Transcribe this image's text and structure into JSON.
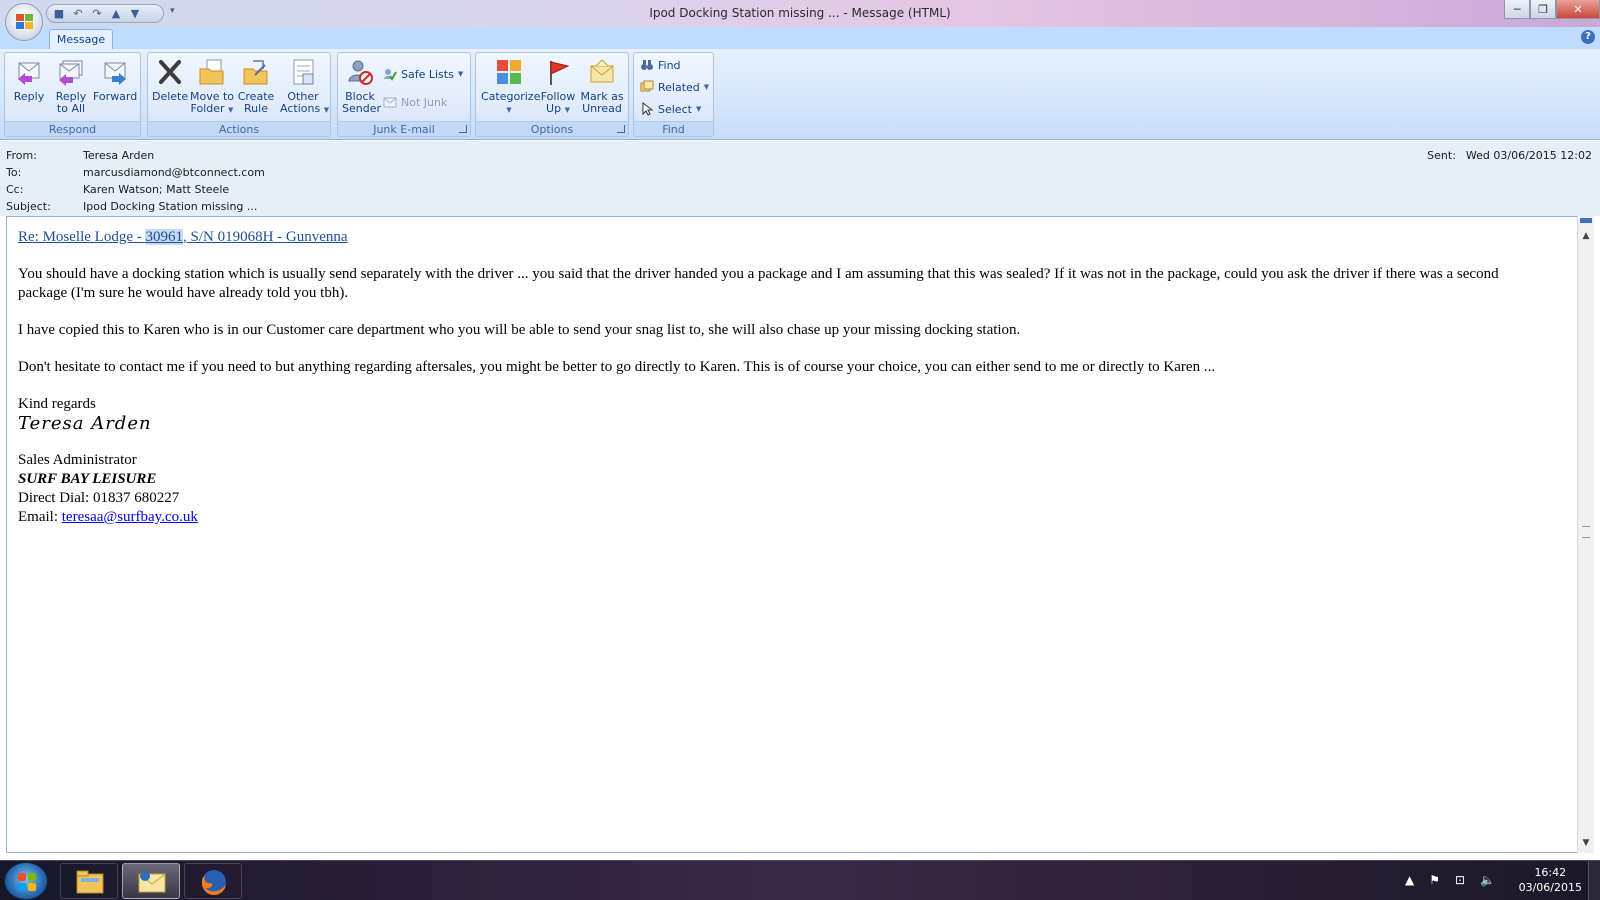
{
  "window": {
    "title": "Ipod Docking Station missing ... - Message (HTML)",
    "controls": {
      "minimize": "─",
      "maximize": "❐",
      "close": "✕"
    }
  },
  "quick_access": {
    "more": "▾"
  },
  "tabs": [
    {
      "label": "Message"
    }
  ],
  "help": "?",
  "ribbon": {
    "respond": {
      "label": "Respond",
      "reply": "Reply",
      "reply_all_1": "Reply",
      "reply_all_2": "to All",
      "forward": "Forward"
    },
    "actions": {
      "label": "Actions",
      "delete": "Delete",
      "move_1": "Move to",
      "move_2": "Folder",
      "rule_1": "Create",
      "rule_2": "Rule",
      "other_1": "Other",
      "other_2": "Actions"
    },
    "junk": {
      "label": "Junk E-mail",
      "block_1": "Block",
      "block_2": "Sender",
      "safe_lists": "Safe Lists",
      "not_junk": "Not Junk"
    },
    "options": {
      "label": "Options",
      "categorize": "Categorize",
      "follow_1": "Follow",
      "follow_2": "Up",
      "mark_1": "Mark as",
      "mark_2": "Unread"
    },
    "find": {
      "label": "Find",
      "find": "Find",
      "related": "Related",
      "select": "Select"
    }
  },
  "header": {
    "from_label": "From:",
    "from": "Teresa Arden",
    "to_label": "To:",
    "to": "marcusdiamond@btconnect.com",
    "cc_label": "Cc:",
    "cc": "Karen Watson; Matt Steele",
    "subject_label": "Subject:",
    "subject": "Ipod Docking Station missing ...",
    "sent_label": "Sent:",
    "sent": "Wed 03/06/2015 12:02"
  },
  "body": {
    "re_prefix": "Re:  Moselle Lodge - ",
    "re_highlight": "30961",
    "re_suffix": ", S/N 019068H - Gunvenna",
    "p1": "You should have a docking station which is usually send separately with the driver ... you said that the driver handed you a package and I am assuming that this was sealed?  If it was not in the package, could you ask the driver if there was a second package (I'm sure he would have already told you tbh).",
    "p2": "I have copied this to Karen who is in our Customer care department who you will be able to send your snag list to, she will also chase up your missing docking station.",
    "p3": "Don't hesitate to contact me if you need to but anything regarding aftersales, you might be better to go directly to Karen.  This is of course your choice, you can either send to me or directly to Karen ...",
    "regards": "Kind regards",
    "signature": "Teresa Arden",
    "role": "Sales Administrator",
    "company": "SURF BAY LEISURE",
    "direct_dial": "Direct Dial:  01837 680227",
    "email_label": "Email:  ",
    "email": "teresaa@surfbay.co.uk"
  },
  "taskbar": {
    "time": "16:42",
    "date": "03/06/2015"
  }
}
